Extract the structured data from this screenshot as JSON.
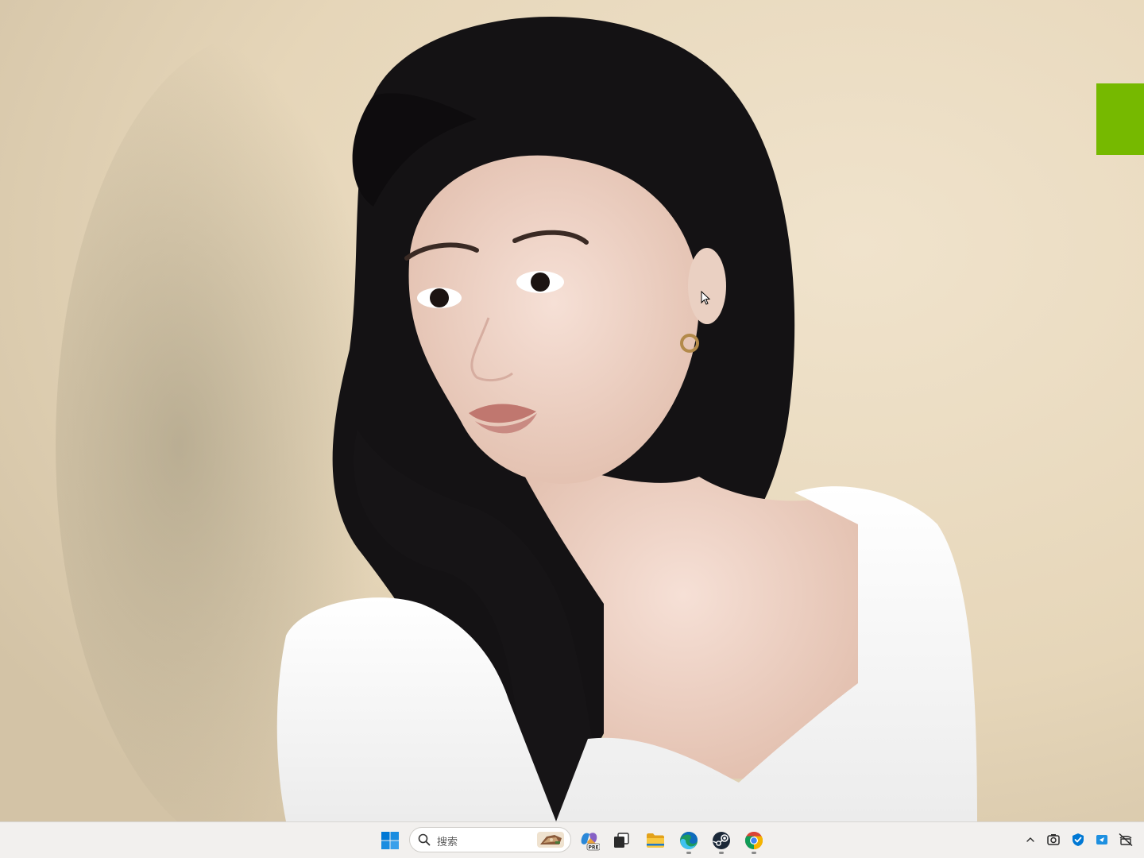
{
  "taskbar": {
    "search": {
      "placeholder": "搜索"
    },
    "pinned_apps": [
      {
        "name": "start-button",
        "icon": "windows-logo-icon"
      },
      {
        "name": "copilot",
        "icon": "copilot-pre-icon",
        "badge": "PRE"
      },
      {
        "name": "task-view",
        "icon": "task-view-icon"
      },
      {
        "name": "file-explorer",
        "icon": "folder-icon"
      },
      {
        "name": "edge",
        "icon": "edge-icon"
      },
      {
        "name": "steam",
        "icon": "steam-icon"
      },
      {
        "name": "chrome",
        "icon": "chrome-icon"
      }
    ],
    "tray": [
      {
        "name": "show-hidden-icons",
        "icon": "chevron-up-icon"
      },
      {
        "name": "app-tray",
        "icon": "camera-app-icon"
      },
      {
        "name": "security",
        "icon": "windows-security-icon"
      },
      {
        "name": "bluetooth-app",
        "icon": "tray-app-icon"
      },
      {
        "name": "network",
        "icon": "network-offline-icon"
      }
    ]
  },
  "colors": {
    "taskbar_bg": "#f2f0ee",
    "green_widget": "#76b900",
    "windows_blue": "#0078d4"
  }
}
